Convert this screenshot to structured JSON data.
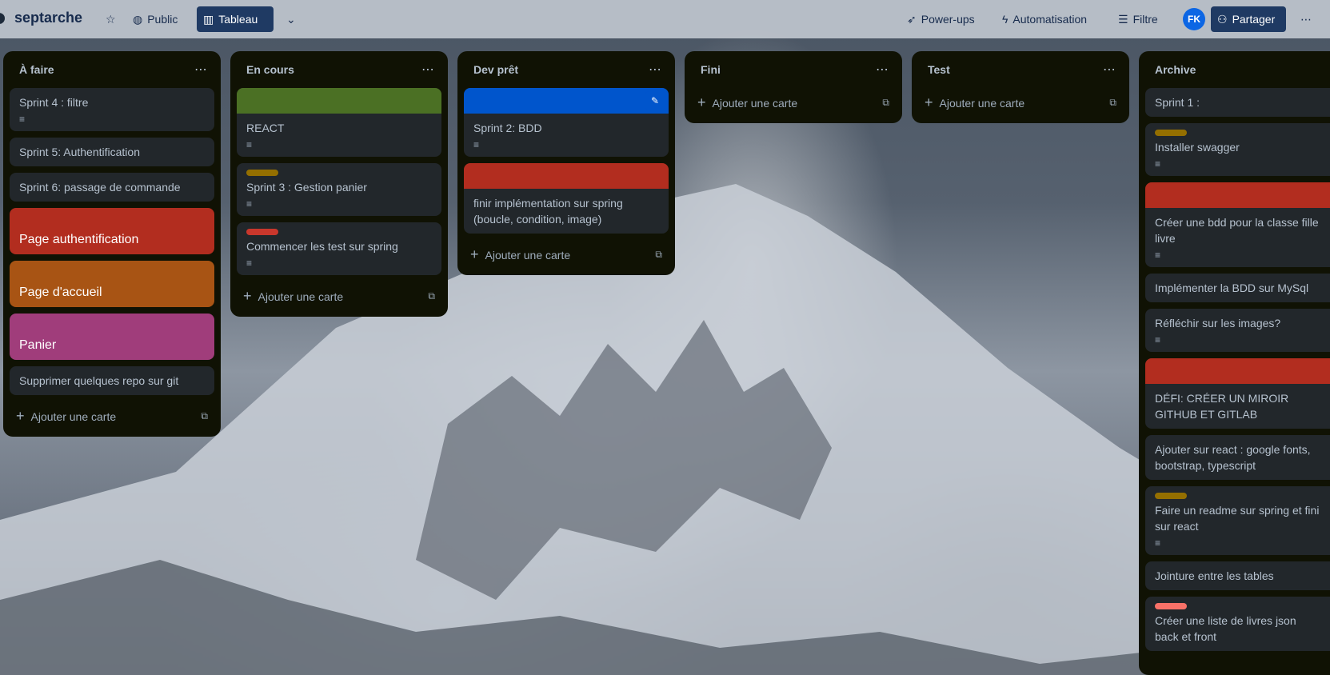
{
  "board": {
    "title": "septarche",
    "visibility": "Public",
    "view": "Tableau",
    "powerups": "Power-ups",
    "automation": "Automatisation",
    "filter": "Filtre",
    "avatar": "FK",
    "share": "Partager"
  },
  "add_card_label": "Ajouter une carte",
  "lists": [
    {
      "title": "À faire",
      "cards": [
        {
          "text": "Sprint 4 : filtre",
          "desc": true
        },
        {
          "text": "Sprint 5: Authentification"
        },
        {
          "text": "Sprint 6: passage de commande"
        },
        {
          "text": "Page authentification",
          "cover": "#b22d1f"
        },
        {
          "text": "Page d'accueil",
          "cover": "#a85414"
        },
        {
          "text": "Panier",
          "cover": "#a03d7b"
        },
        {
          "text": "Supprimer quelques repo sur git"
        }
      ]
    },
    {
      "title": "En cours",
      "cards": [
        {
          "text": "REACT",
          "topcover": "#4b7024",
          "desc": true
        },
        {
          "text": "Sprint 3 : Gestion panier",
          "label": "#946f00",
          "desc": true
        },
        {
          "text": "Commencer les test sur spring",
          "label": "#c9372c",
          "desc": true
        }
      ]
    },
    {
      "title": "Dev prêt",
      "cards": [
        {
          "text": "Sprint 2: BDD",
          "topcover": "#0055cc",
          "desc": true,
          "editing": true
        },
        {
          "text": "finir implémentation sur spring (boucle, condition, image)",
          "topcover": "#b22d1f"
        }
      ]
    },
    {
      "title": "Fini",
      "cards": []
    },
    {
      "title": "Test",
      "cards": []
    },
    {
      "title": "Archive",
      "cards": [
        {
          "text": "Sprint 1 :"
        },
        {
          "text": "Installer swagger",
          "label": "#946f00",
          "desc": true
        },
        {
          "text": "Créer une bdd pour la classe fille livre",
          "topcover": "#b22d1f",
          "desc": true
        },
        {
          "text": "Implémenter la BDD sur MySql"
        },
        {
          "text": "Réfléchir sur les images?",
          "desc": true
        },
        {
          "text": "DÉFI: CRÉER UN MIROIR GITHUB ET GITLAB",
          "topcover": "#b22d1f"
        },
        {
          "text": "Ajouter sur react : google fonts, bootstrap, typescript"
        },
        {
          "text": "Faire un readme sur spring et fini sur react",
          "label": "#946f00",
          "desc": true
        },
        {
          "text": "Jointure entre les tables"
        },
        {
          "text": "Créer une liste de livres json back et front",
          "label": "#f87168"
        }
      ]
    }
  ],
  "icons": {
    "star": "star-icon",
    "globe": "globe-icon",
    "board": "board-icon",
    "chevron": "chevron-down-icon",
    "rocket": "rocket-icon",
    "bolt": "bolt-icon",
    "filter": "filter-icon",
    "share": "add-person-icon",
    "more": "more-icon",
    "desc": "description-icon",
    "template": "template-icon",
    "edit": "pencil-icon"
  }
}
